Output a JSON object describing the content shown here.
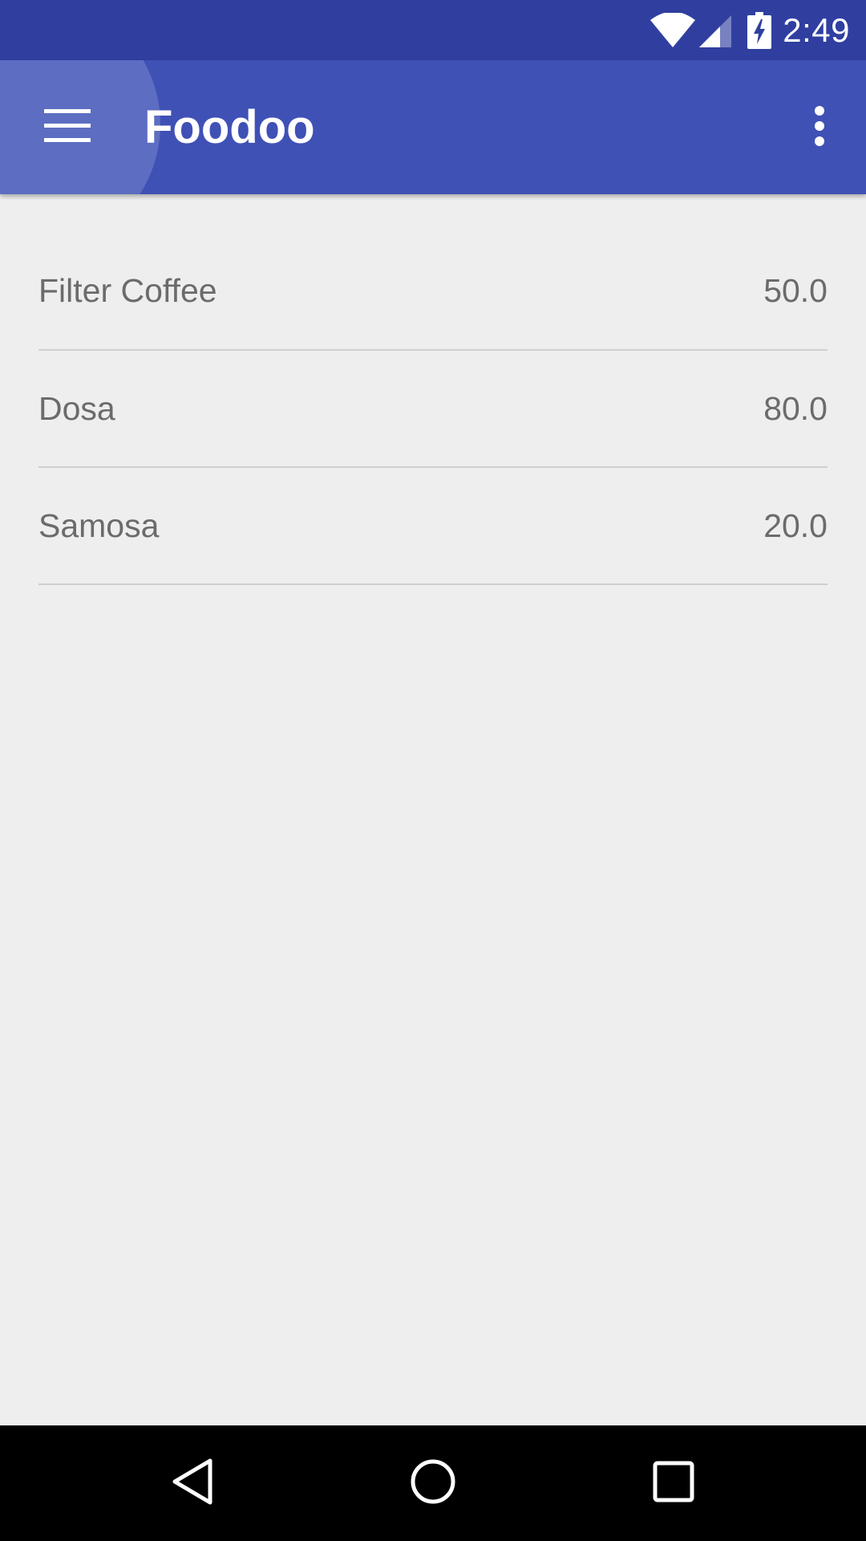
{
  "status_bar": {
    "time": "2:49",
    "icons": [
      "wifi-icon",
      "cellular-signal-icon",
      "battery-charging-icon"
    ]
  },
  "app_bar": {
    "title": "Foodoo",
    "color": "#3f51b5",
    "status_color": "#303f9f",
    "left_icon": "hamburger-menu-icon",
    "right_icon": "overflow-menu-icon"
  },
  "items": [
    {
      "name": "Filter Coffee",
      "price": "50.0"
    },
    {
      "name": "Dosa",
      "price": "80.0"
    },
    {
      "name": "Samosa",
      "price": "20.0"
    }
  ],
  "nav_bar": {
    "buttons": [
      "back-icon",
      "home-icon",
      "recents-icon"
    ]
  }
}
